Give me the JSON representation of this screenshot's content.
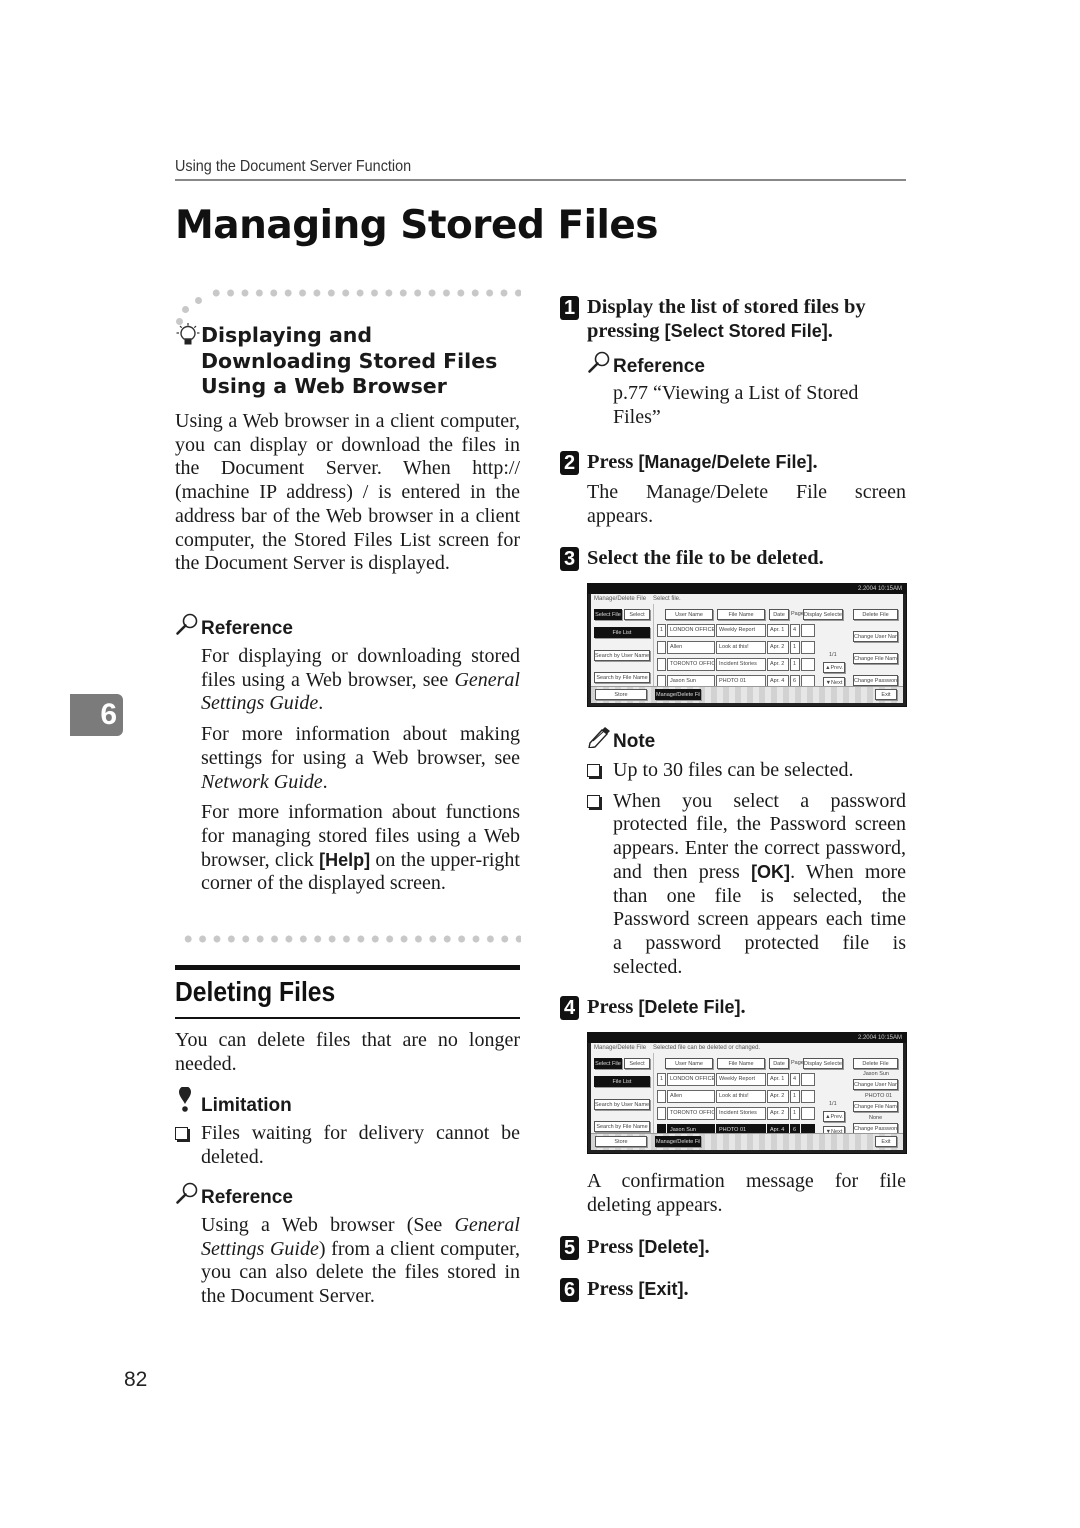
{
  "header": {
    "running_title": "Using the Document Server Function",
    "page_title": "Managing Stored Files"
  },
  "chapter_tab": "6",
  "page_number": "82",
  "left": {
    "tip_heading": "Displaying and Downloading Stored Files Using a Web Browser",
    "tip_body": "Using a Web browser in a client computer, you can display or download the files in the Document Server. When http:// (machine IP address) / is entered in the address bar of the Web browser in a client computer, the Stored Files List screen for the Document Server is displayed.",
    "reference_label": "Reference",
    "ref_p1_a": "For displaying or downloading stored files using a Web browser, see ",
    "ref_p1_italic": "General Settings Guide",
    "ref_p1_b": ".",
    "ref_p2_a": "For more information about making settings for using a Web browser, see ",
    "ref_p2_italic": "Network Guide",
    "ref_p2_b": ".",
    "ref_p3_a": "For more information about functions for managing stored files using a Web browser, click ",
    "ref_p3_key": "[Help]",
    "ref_p3_b": " on the upper-right corner of the displayed screen.",
    "deleting_heading": "Deleting Files",
    "deleting_intro": "You can delete files that are no longer needed.",
    "limitation_label": "Limitation",
    "limitation_items": [
      "Files waiting for delivery cannot be deleted."
    ],
    "reference2_label": "Reference",
    "ref2_a": "Using a Web browser (See ",
    "ref2_italic": "General Settings Guide",
    "ref2_b": ") from a client computer, you can also delete the files stored in the Document Server."
  },
  "steps": [
    {
      "number": "1",
      "text_a": "Display the list of stored files by pressing ",
      "key": "[Select Stored File]",
      "text_b": ".",
      "reference_label": "Reference",
      "reference_text": "p.77 “Viewing a List of Stored Files”"
    },
    {
      "number": "2",
      "text_a": "Press ",
      "key": "[Manage/Delete File]",
      "text_b": ".",
      "body": "The Manage/Delete File screen appears."
    },
    {
      "number": "3",
      "text_a": "Select the file to be deleted.",
      "note_label": "Note",
      "note_item_1": "Up to 30 files can be selected.",
      "note_item_2_a": "When you select a password protected file, the Password screen appears. Enter the correct password, and then press ",
      "note_item_2_key": "[OK]",
      "note_item_2_b": ". When more than one file is selected, the Password screen appears each time a password protected file is selected."
    },
    {
      "number": "4",
      "text_a": "Press ",
      "key": "[Delete File]",
      "text_b": ".",
      "body": "A confirmation message for file deleting appears."
    },
    {
      "number": "5",
      "text_a": "Press ",
      "key": "[Delete]",
      "text_b": "."
    },
    {
      "number": "6",
      "text_a": "Press ",
      "key": "[Exit]",
      "text_b": "."
    }
  ],
  "screen1": {
    "status": "2.2004 10:15AM",
    "title": "Manage/Delete File",
    "message": "Select file.",
    "tabs": [
      "Select File",
      "Select"
    ],
    "file_list_button": "File List",
    "search_user_button": "Search by User Name",
    "search_file_button": "Search by File Name",
    "sort_headers": [
      "User Name",
      "File Name",
      "Date",
      "Page",
      "Display Selected"
    ],
    "rows": [
      {
        "num": "1",
        "user": "LONDON OFFICE",
        "file": "Weekly Report",
        "date": "Apr. 1",
        "pages": "4"
      },
      {
        "num": "",
        "user": "Allen",
        "file": "Look at this!",
        "date": "Apr. 2",
        "pages": "1"
      },
      {
        "num": "",
        "user": "TORONTO OFFICE",
        "file": "Incident Stories",
        "date": "Apr. 2",
        "pages": "1"
      },
      {
        "num": "",
        "user": "Jason Sun",
        "file": "PHOTO 01",
        "date": "Apr. 4",
        "pages": "6"
      }
    ],
    "page_indicator": "1/1",
    "prev_button": "▲Prev.",
    "next_button": "▼Next",
    "right_buttons": [
      "Delete File",
      "Change User Name",
      "Change File Name",
      "Change Password"
    ],
    "bottom_left": "Store",
    "bottom_active": "Manage/Delete File",
    "exit_button": "Exit"
  },
  "screen2": {
    "status": "2.2004 10:15AM",
    "title": "Manage/Delete File",
    "message": "Selected file can be deleted or changed.",
    "right_buttons": [
      "Delete File",
      "Change User Name",
      "Change File Name",
      "Change Password"
    ],
    "right_labels": [
      "Jason Sun",
      "PHOTO 01",
      "None"
    ]
  }
}
